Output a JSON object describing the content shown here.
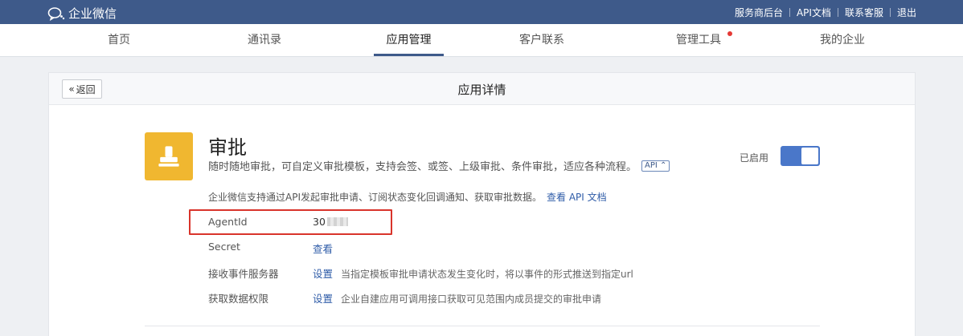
{
  "topbar": {
    "brand": "企业微信",
    "links": [
      "服务商后台",
      "API文档",
      "联系客服",
      "退出"
    ]
  },
  "nav": {
    "items": [
      "首页",
      "通讯录",
      "应用管理",
      "客户联系",
      "管理工具",
      "我的企业"
    ],
    "active": "应用管理"
  },
  "panel": {
    "back_label": "返回",
    "title": "应用详情"
  },
  "app": {
    "name": "审批",
    "description": "随时随地审批，可自定义审批模板，支持会签、或签、上级审批、条件审批，适应各种流程。",
    "api_tag": "API",
    "status_label": "已启用",
    "enabled": true,
    "icon": "stamp-icon",
    "icon_color": "#f0b730"
  },
  "api_note": {
    "text": "企业微信支持通过API发起审批申请、订阅状态变化回调通知、获取审批数据。",
    "link": "查看 API 文档"
  },
  "rows": [
    {
      "label": "AgentId",
      "value": "30"
    },
    {
      "label": "Secret",
      "link": "查看"
    },
    {
      "label": "接收事件服务器",
      "link": "设置",
      "hint": "当指定模板审批申请状态发生变化时，将以事件的形式推送到指定url"
    },
    {
      "label": "获取数据权限",
      "link": "设置",
      "hint": "企业自建应用可调用接口获取可见范围内成员提交的审批申请"
    }
  ],
  "colors": {
    "topbar": "#3e5a8a",
    "accent": "#4a77c9",
    "highlight": "#d9342b"
  }
}
